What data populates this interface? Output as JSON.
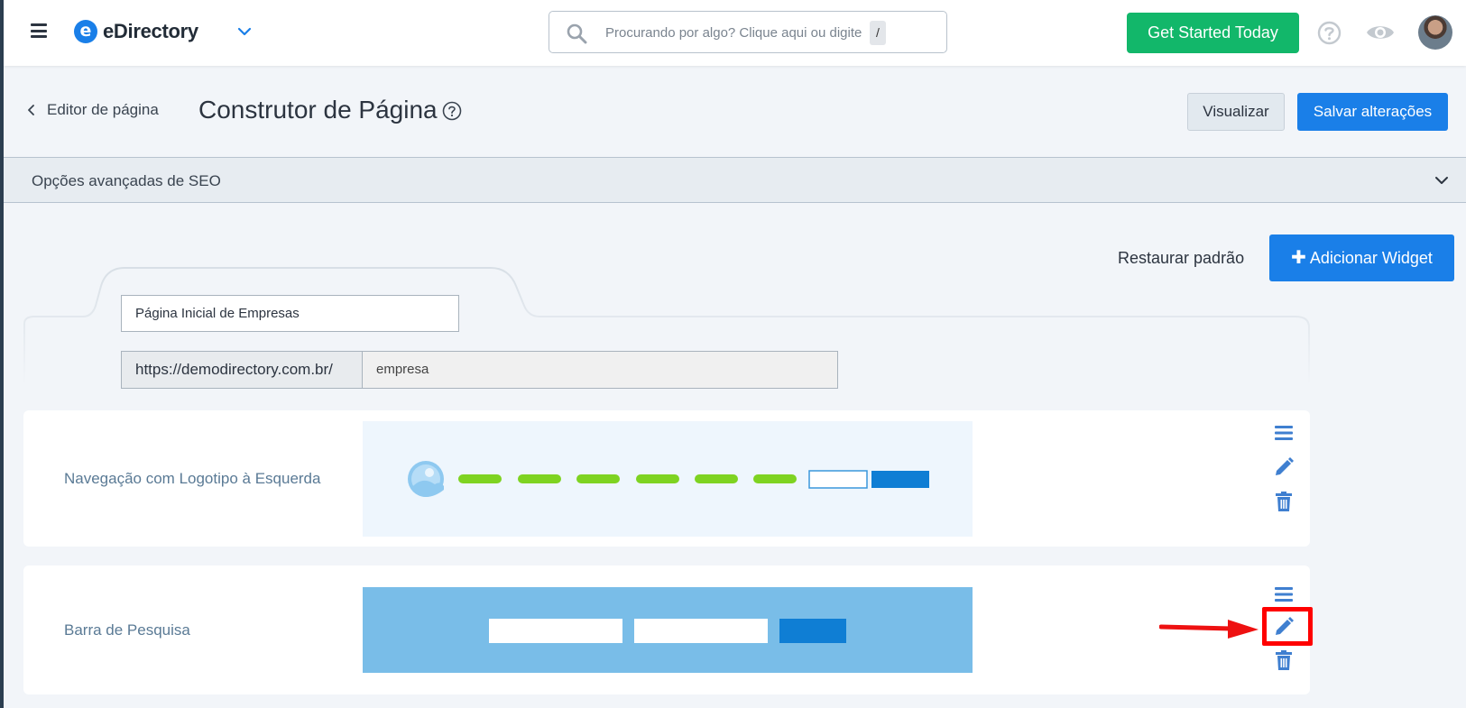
{
  "topbar": {
    "brand": "eDirectory",
    "brand_badge": "e",
    "search_placeholder": "Procurando por algo? Clique aqui ou digite",
    "search_shortcut": "/",
    "get_started_label": "Get Started Today"
  },
  "header": {
    "back_label": "Editor de página",
    "title": "Construtor de Página",
    "preview_label": "Visualizar",
    "save_label": "Salvar alterações"
  },
  "seo": {
    "label": "Opções avançadas de SEO"
  },
  "actions": {
    "restore_label": "Restaurar padrão",
    "add_widget_label": "Adicionar Widget",
    "add_widget_icon": "plus"
  },
  "page_config": {
    "page_name": "Página Inicial de Empresas",
    "url_prefix": "https://demodirectory.com.br/",
    "url_slug": "empresa"
  },
  "widgets": [
    {
      "label": "Navegação com Logotipo à Esquerda",
      "icons": [
        "drag-handle-icon",
        "edit-pencil-icon",
        "trash-icon"
      ]
    },
    {
      "label": "Barra de Pesquisa",
      "icons": [
        "drag-handle-icon",
        "edit-pencil-icon",
        "trash-icon"
      ]
    }
  ],
  "colors": {
    "primary": "#1a7fe8",
    "success": "#12b76a",
    "nav_preview_bg": "#eef6fd",
    "nav_preview_links": "#7ed321",
    "search_preview_bg": "#79bde8",
    "highlight": "#ff0000"
  }
}
